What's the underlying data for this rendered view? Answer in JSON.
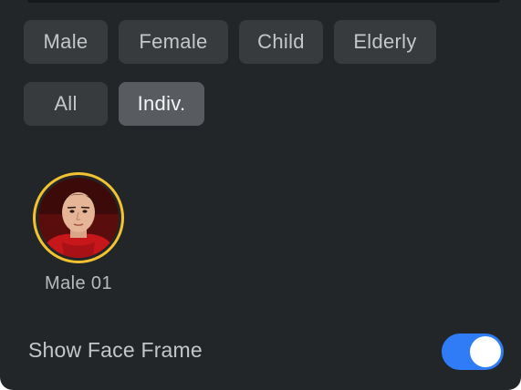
{
  "filters": {
    "row1": [
      "Male",
      "Female",
      "Child",
      "Elderly"
    ],
    "row2": [
      "All",
      "Indiv."
    ],
    "selected": "Indiv."
  },
  "faces": [
    {
      "label": "Male 01",
      "selected": true
    }
  ],
  "settings": {
    "show_face_frame_label": "Show Face Frame",
    "show_face_frame_on": true
  },
  "colors": {
    "panel_bg": "#232629",
    "chip_bg": "#373b3e",
    "chip_selected_bg": "#585c60",
    "selection_ring": "#f2c230",
    "toggle_on": "#2f7cf6"
  }
}
